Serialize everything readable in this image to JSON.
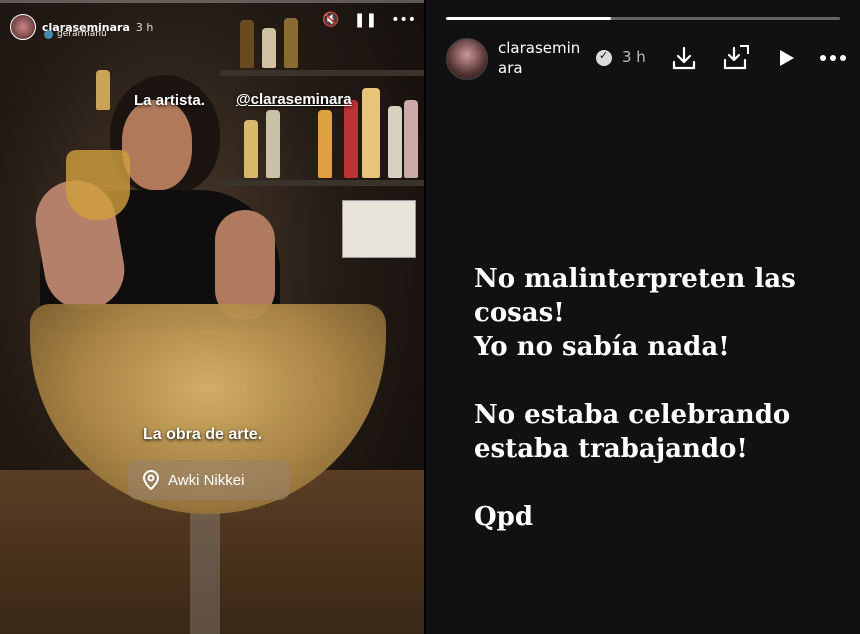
{
  "left_story": {
    "username": "claraseminara",
    "time": "3 h",
    "collab": "gerarmanu",
    "tag_artist": "La artista.",
    "mention": "@claraseminara",
    "tag_artwork": "La obra de arte.",
    "location": "Awki Nikkei"
  },
  "right_story": {
    "username": "claraseminara",
    "time": "3 h",
    "progress": 0.42,
    "message_lines": [
      "No malinterpreten las cosas!",
      "Yo no sabía nada!",
      "",
      "No estaba celebrando estaba trabajando!",
      "",
      "Qpd"
    ],
    "icons": [
      "download-icon",
      "save-all-icon",
      "play-icon",
      "more-icon"
    ]
  }
}
